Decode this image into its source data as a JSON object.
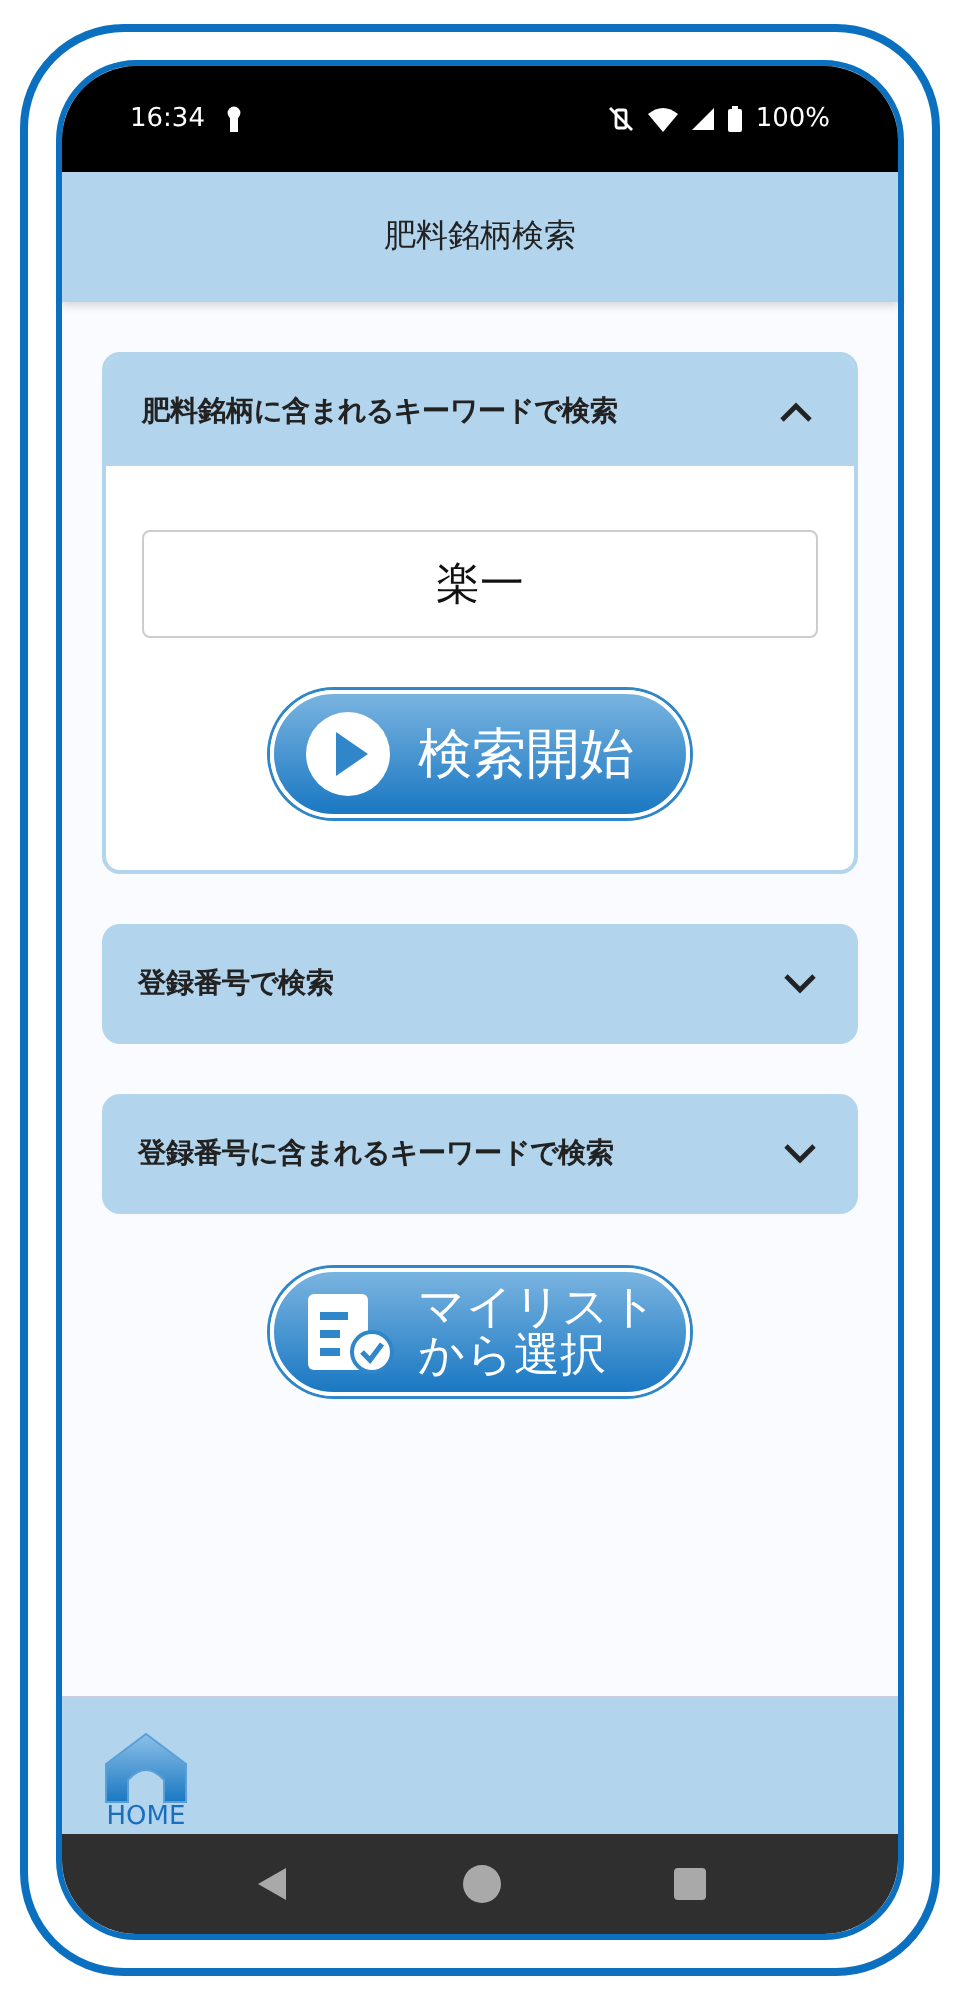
{
  "status_bar": {
    "time": "16:34",
    "battery": "100%"
  },
  "header": {
    "title": "肥料銘柄検索"
  },
  "sections": [
    {
      "title": "肥料銘柄に含まれるキーワードで検索",
      "expanded": true,
      "field": {
        "value": "楽一"
      },
      "button": "検索開始"
    },
    {
      "title": "登録番号で検索",
      "expanded": false
    },
    {
      "title": "登録番号に含まれるキーワードで検索",
      "expanded": false
    }
  ],
  "mylist_button": [
    "マイリスト",
    "から選択"
  ],
  "footer": {
    "home_label": "HOME"
  }
}
